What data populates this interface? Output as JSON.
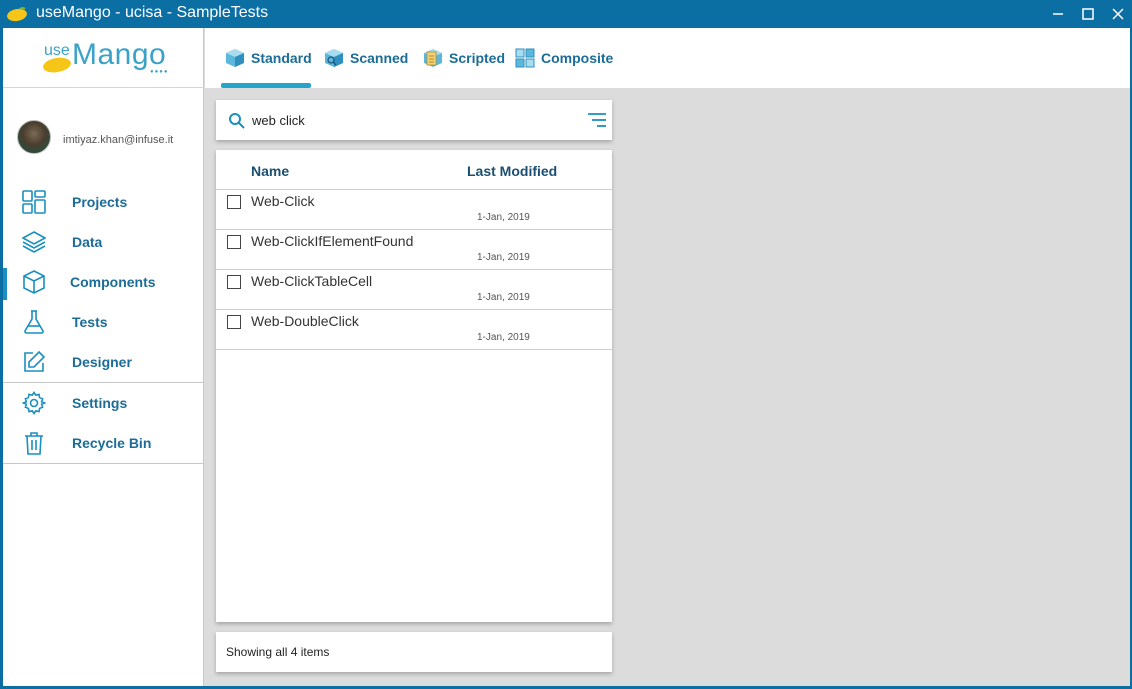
{
  "window": {
    "title": "useMango - ucisa - SampleTests"
  },
  "logo": {
    "use": "use",
    "mango": "Mango"
  },
  "user": {
    "email": "imtiyaz.khan@infuse.it"
  },
  "sidebar": {
    "items": [
      {
        "label": "Projects",
        "icon": "projects-icon"
      },
      {
        "label": "Data",
        "icon": "layers-icon"
      },
      {
        "label": "Components",
        "icon": "cube-icon"
      },
      {
        "label": "Tests",
        "icon": "flask-icon"
      },
      {
        "label": "Designer",
        "icon": "edit-icon"
      },
      {
        "label": "Settings",
        "icon": "gear-icon"
      },
      {
        "label": "Recycle Bin",
        "icon": "trash-icon"
      }
    ],
    "active": "Components"
  },
  "tabs": [
    {
      "label": "Standard",
      "icon": "standard-cube-icon"
    },
    {
      "label": "Scanned",
      "icon": "scanned-cube-icon"
    },
    {
      "label": "Scripted",
      "icon": "scripted-cube-icon"
    },
    {
      "label": "Composite",
      "icon": "composite-cube-icon"
    }
  ],
  "active_tab": "Standard",
  "search": {
    "value": "web click"
  },
  "list": {
    "columns": {
      "name": "Name",
      "modified": "Last Modified"
    },
    "rows": [
      {
        "name": "Web-Click",
        "date": "1-Jan, 2019"
      },
      {
        "name": "Web-ClickIfElementFound",
        "date": "1-Jan, 2019"
      },
      {
        "name": "Web-ClickTableCell",
        "date": "1-Jan, 2019"
      },
      {
        "name": "Web-DoubleClick",
        "date": "1-Jan, 2019"
      }
    ]
  },
  "footer": {
    "status": "Showing all 4 items"
  },
  "colors": {
    "titlebar": "#0b6fa4",
    "accent": "#25a5c9",
    "nav_text": "#1b6d97"
  }
}
